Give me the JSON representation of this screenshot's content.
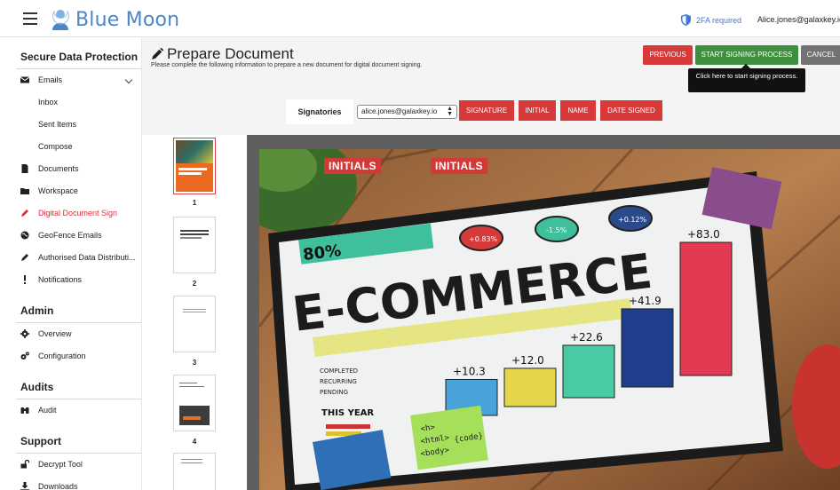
{
  "app": {
    "logo_text": "Blue Moon",
    "twofa_label": "2FA required",
    "user_email": "Alice.jones@galaxkey.io"
  },
  "sidebar": {
    "sections": [
      {
        "title": "Secure Data Protection"
      },
      {
        "title": "Admin"
      },
      {
        "title": "Audits"
      },
      {
        "title": "Support"
      }
    ],
    "items": [
      {
        "label": "Emails",
        "icon": "envelope-icon"
      },
      {
        "label": "Inbox"
      },
      {
        "label": "Sent Items"
      },
      {
        "label": "Compose"
      },
      {
        "label": "Documents",
        "icon": "document-icon"
      },
      {
        "label": "Workspace",
        "icon": "folder-icon"
      },
      {
        "label": "Digital Document Sign",
        "icon": "pen-icon",
        "active": true
      },
      {
        "label": "GeoFence Emails",
        "icon": "globe-icon"
      },
      {
        "label": "Authorised Data Distributi...",
        "icon": "pen-icon"
      },
      {
        "label": "Notifications",
        "icon": "exclamation-icon"
      },
      {
        "label": "Overview",
        "icon": "gear-icon"
      },
      {
        "label": "Configuration",
        "icon": "gears-icon"
      },
      {
        "label": "Audit",
        "icon": "binoculars-icon"
      },
      {
        "label": "Decrypt Tool",
        "icon": "unlock-icon"
      },
      {
        "label": "Downloads",
        "icon": "download-icon"
      }
    ]
  },
  "main": {
    "title": "Prepare Document",
    "subtitle": "Please complete the following information to prepare a new document for digital document signing.",
    "buttons": {
      "previous": "PREVIOUS",
      "start": "START SIGNING PROCESS",
      "cancel": "CANCEL"
    },
    "tooltip": "Click here to start signing process.",
    "signatories_label": "Signatories",
    "signatory_selected": "alice.jones@galaxkey.io",
    "fields": [
      "SIGNATURE",
      "INITIAL",
      "NAME",
      "DATE SIGNED"
    ],
    "thumbnails": [
      "1",
      "2",
      "3",
      "4"
    ],
    "placed_tags": [
      "INITIALS",
      "INITIALS"
    ]
  },
  "document_image": {
    "headline": "E-COMMERCE",
    "percent": "80%",
    "bar_labels": [
      "+10.3",
      "+12.0",
      "+22.6",
      "+41.9",
      "+83.0"
    ],
    "bar_levels": [
      10.3,
      12.0,
      22.6,
      41.9,
      83.0
    ],
    "circle_labels": [
      "+0.83%",
      "-1.5%",
      "+0.12%"
    ],
    "small_text": [
      "COMPLETED",
      "RECURRING",
      "PENDING",
      "THIS YEAR"
    ],
    "sticky_note": [
      "<h>",
      "<html>",
      "<body>",
      "{code}"
    ]
  },
  "colors": {
    "accent_red": "#d83a3a",
    "start_green": "#3e8f3e",
    "cancel_gray": "#727272",
    "link_blue": "#3d7bd9",
    "active_red": "#d7323a"
  }
}
